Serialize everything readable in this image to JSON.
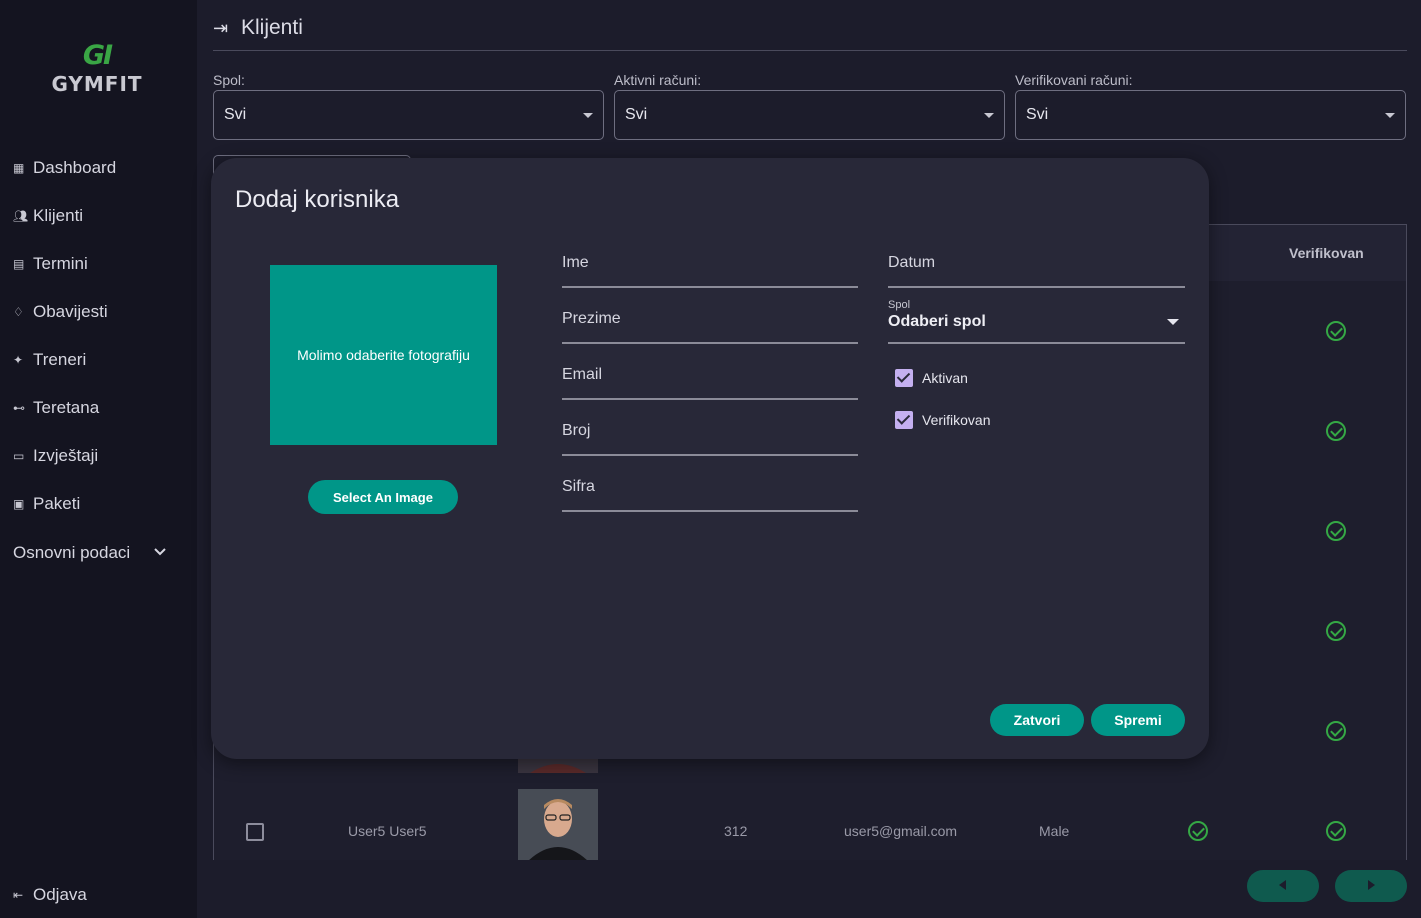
{
  "brand": {
    "mark": "GI",
    "name": "GYMFIT"
  },
  "sidebar": {
    "items": [
      {
        "label": "Dashboard",
        "icon": "dashboard-icon"
      },
      {
        "label": "Klijenti",
        "icon": "users-icon"
      },
      {
        "label": "Termini",
        "icon": "calendar-icon"
      },
      {
        "label": "Obavijesti",
        "icon": "bell-icon"
      },
      {
        "label": "Treneri",
        "icon": "trainer-icon"
      },
      {
        "label": "Teretana",
        "icon": "dumbbell-icon"
      },
      {
        "label": "Izvještaji",
        "icon": "report-icon"
      },
      {
        "label": "Paketi",
        "icon": "package-icon"
      }
    ],
    "group": {
      "label": "Osnovni podaci",
      "icon": "chevron-down-icon"
    },
    "logout": {
      "label": "Odjava",
      "icon": "logout-icon"
    }
  },
  "page": {
    "title": "Klijenti",
    "title_icon": "login-icon"
  },
  "filters": [
    {
      "label": "Spol:",
      "value": "Svi"
    },
    {
      "label": "Aktivni računi:",
      "value": "Svi"
    },
    {
      "label": "Verifikovani računi:",
      "value": "Svi"
    }
  ],
  "table": {
    "headers": {
      "verified": "Verifikovan"
    },
    "last_row": {
      "name": "User5 User5",
      "number": "312",
      "email": "user5@gmail.com",
      "gender": "Male"
    }
  },
  "modal": {
    "title": "Dodaj korisnika",
    "photo_placeholder": "Molimo odaberite fotografiju",
    "select_image_label": "Select An Image",
    "fields_left": [
      "Ime",
      "Prezime",
      "Email",
      "Broj",
      "Sifra"
    ],
    "date_label": "Datum",
    "gender": {
      "label": "Spol",
      "value": "Odaberi spol"
    },
    "checkboxes": [
      {
        "label": "Aktivan",
        "checked": true
      },
      {
        "label": "Verifikovan",
        "checked": true
      }
    ],
    "close_label": "Zatvori",
    "save_label": "Spremi"
  },
  "colors": {
    "accent": "#009688",
    "success": "#35a845",
    "checkbox": "#c4b0f0"
  }
}
